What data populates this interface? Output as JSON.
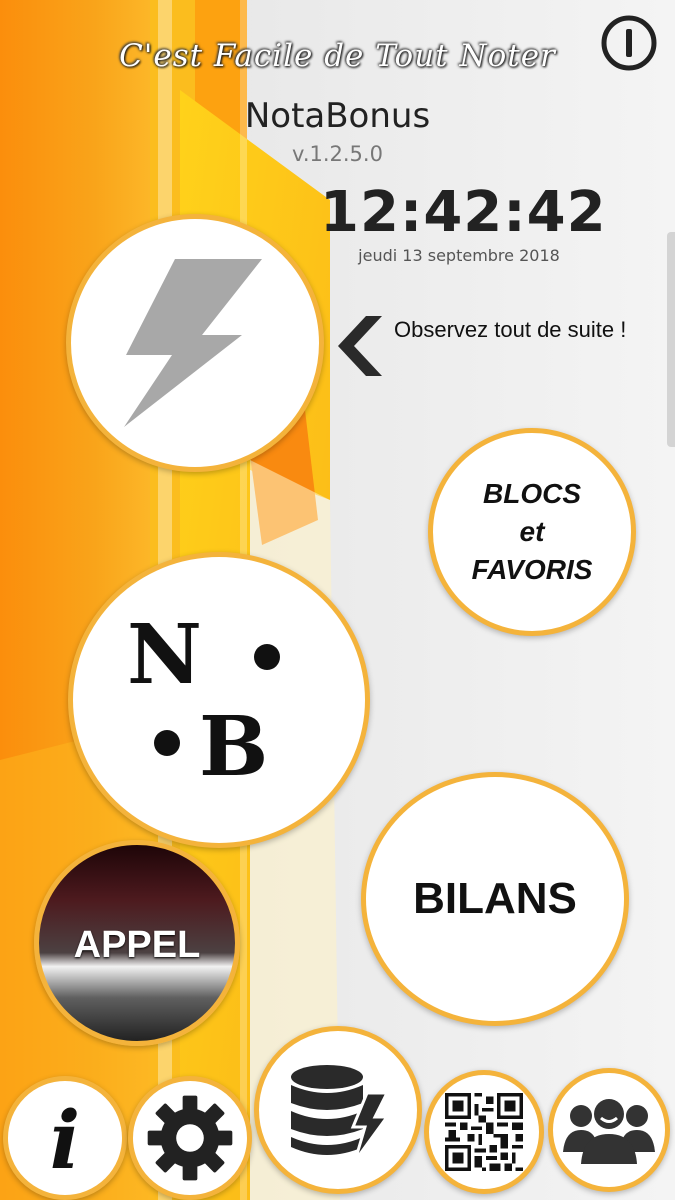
{
  "header": {
    "tagline": "C'est Facile de Tout Noter",
    "app_name": "NotaBonus",
    "version": "v.1.2.5.0",
    "time": "12:42:42",
    "date": "jeudi 13 septembre 2018"
  },
  "hint": {
    "text": "Observez tout de suite !"
  },
  "buttons": {
    "blocs_line1": "BLOCS",
    "blocs_line2": "et",
    "blocs_line3": "FAVORIS",
    "bilans": "BILANS",
    "appel": "APPEL",
    "info": "i",
    "logo_n": "N",
    "logo_b": "B"
  },
  "icons": {
    "power": "power-icon",
    "flash": "lightning-icon",
    "logo": "nb-logo",
    "chevron": "chevron-left-icon",
    "info": "info-icon",
    "settings": "gear-icon",
    "database": "database-flash-icon",
    "qr": "qr-code-icon",
    "users": "users-icon"
  },
  "colors": {
    "accent": "#f4b33b",
    "orange": "#f7941d",
    "yellow": "#ffd21a"
  }
}
